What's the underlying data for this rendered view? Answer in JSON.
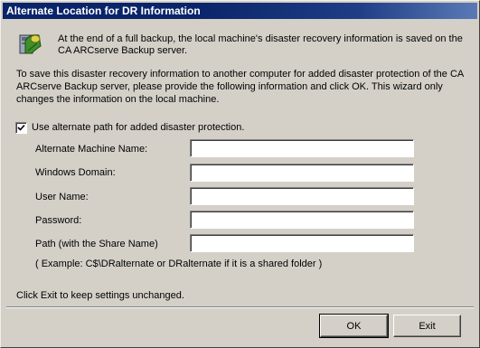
{
  "window": {
    "title": "Alternate Location for DR Information"
  },
  "intro": {
    "line1": "At the end of a full backup, the local machine's disaster recovery information is saved on the",
    "line2": "CA ARCserve Backup server."
  },
  "instructions": {
    "line1": "To save this disaster recovery information to another computer for added disaster protection of the CA",
    "line2": "ARCserve Backup server, please provide the following information and click OK. This wizard only",
    "line3": "changes the information on the local machine."
  },
  "alternate_path": {
    "label": "Use alternate path for added disaster protection.",
    "checked": true
  },
  "fields": {
    "machine_name": {
      "label": "Alternate Machine Name:",
      "value": ""
    },
    "windows_domain": {
      "label": "Windows Domain:",
      "value": ""
    },
    "user_name": {
      "label": "User Name:",
      "value": ""
    },
    "password": {
      "label": "Password:",
      "value": ""
    },
    "path": {
      "label": "Path (with the Share Name)",
      "value": ""
    }
  },
  "example_text": "( Example: C$\\DRalternate or DRalternate if it is a shared folder )",
  "exit_hint": "Click Exit to keep settings unchanged.",
  "buttons": {
    "ok": "OK",
    "exit": "Exit"
  },
  "icons": {
    "header_icon": "dr-backup-icon",
    "checkbox_mark": "checkmark-icon"
  }
}
